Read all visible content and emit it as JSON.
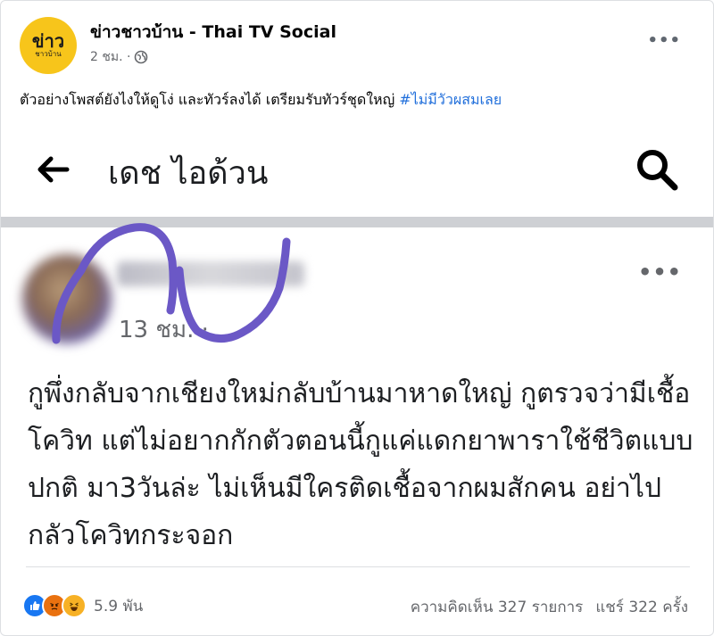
{
  "post": {
    "avatar_big": "ข่าว",
    "avatar_small": "ชาวบ้าน",
    "page_name": "ข่าวชาวบ้าน - Thai TV Social",
    "time": "2 ชม. ·",
    "caption": "ตัวอย่างโพสต์ยังไงให้ดูโง่ และทัวร์ลงได้ เตรียมรับทัวร์ชุดใหญ่ ",
    "hashtag": "#ไม่มีวัวผสมเลย",
    "more_icon": "more-horizontal-icon"
  },
  "screenshot": {
    "title": "เดช ไอด้วน",
    "post_time": "13 ชม. ·",
    "body": "กูพึ่งกลับจากเชียงใหม่กลับบ้านมาหาดใหญ่ กูตรวจว่ามีเชื้อโควิท แต่ไม่อยากกักตัวตอนนี้กูแค่แดกยาพาราใช้ชีวิตแบบปกติ มา3วันล่ะ ไม่เห็นมีใครติดเชื้อจากผมสักคน อย่าไปกลัวโควิทกระจอก"
  },
  "footer": {
    "reaction_count": "5.9 พัน",
    "comments": "ความคิดเห็น 327 รายการ",
    "shares": "แชร์ 322 ครั้ง"
  },
  "colors": {
    "accent": "#216fdb",
    "avatar_bg": "#f7c51b",
    "scribble": "#6b58c6"
  }
}
